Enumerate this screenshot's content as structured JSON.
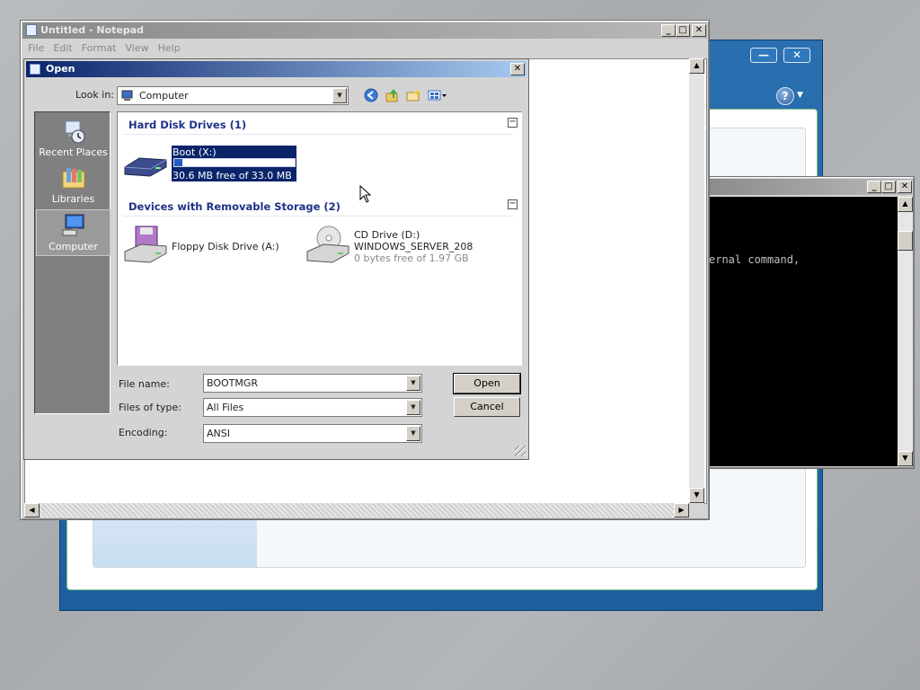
{
  "setup_window": {
    "minimize_glyph": "—",
    "close_glyph": "✕",
    "help_glyph": "?"
  },
  "console": {
    "visible_text": "ernal command,"
  },
  "notepad": {
    "title": "Untitled - Notepad",
    "menu": [
      "File",
      "Edit",
      "Format",
      "View",
      "Help"
    ]
  },
  "open_dialog": {
    "title": "Open",
    "look_in_label": "Look in:",
    "look_in_value": "Computer",
    "places": [
      {
        "label": "Recent Places",
        "icon": "recent-places-icon"
      },
      {
        "label": "Libraries",
        "icon": "libraries-icon"
      },
      {
        "label": "Computer",
        "icon": "computer-icon"
      }
    ],
    "groups": [
      {
        "header": "Hard Disk Drives (1)",
        "items": [
          {
            "name": "Boot (X:)",
            "subtitle": "30.6 MB free of 33.0 MB",
            "used_fraction": 0.07,
            "icon": "hard-disk-icon"
          }
        ]
      },
      {
        "header": "Devices with Removable Storage (2)",
        "items": [
          {
            "name": "Floppy Disk Drive (A:)",
            "icon": "floppy-drive-icon"
          },
          {
            "name": "CD Drive (D:)",
            "label": "WINDOWS_SERVER_208",
            "subtitle": "0 bytes free of 1.97 GB",
            "icon": "cd-drive-icon"
          }
        ]
      }
    ],
    "file_name_label": "File name:",
    "file_name_value": "BOOTMGR",
    "files_of_type_label": "Files of type:",
    "files_of_type_value": "All Files",
    "encoding_label": "Encoding:",
    "encoding_value": "ANSI",
    "open_button": "Open",
    "cancel_button": "Cancel",
    "collapse_glyph": "−"
  },
  "colors": {
    "selection": "#0a246a",
    "dialog_title_start": "#0a246a",
    "dialog_title_end": "#a6caf0",
    "setup_blue": "#1c5f9e",
    "group_header": "#1e3287"
  }
}
